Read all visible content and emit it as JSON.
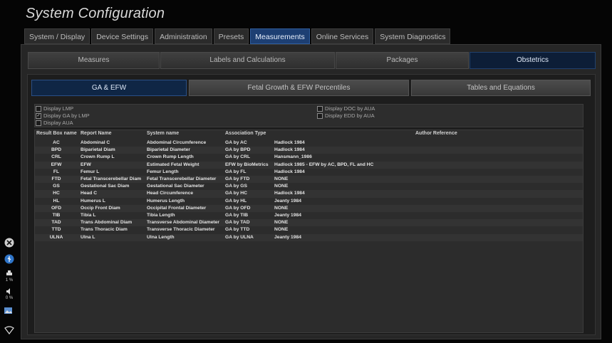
{
  "title": "System Configuration",
  "tabs": [
    "System / Display",
    "Device Settings",
    "Administration",
    "Presets",
    "Measurements",
    "Online Services",
    "System Diagnostics"
  ],
  "active_tab": "Measurements",
  "subtabs": [
    "Measures",
    "Labels and Calculations",
    "Packages",
    "Obstetrics"
  ],
  "active_subtab": "Obstetrics",
  "thirdtabs": [
    "GA & EFW",
    "Fetal Growth & EFW Percentiles",
    "Tables and Equations"
  ],
  "active_thirdtab": "GA & EFW",
  "options": [
    {
      "label": "Display LMP",
      "checked": false
    },
    {
      "label": "Display GA by LMP",
      "checked": true
    },
    {
      "label": "Display AUA",
      "checked": false
    },
    {
      "label": "Display DOC by AUA",
      "checked": false
    },
    {
      "label": "Display EDD by AUA",
      "checked": false
    }
  ],
  "table": {
    "headers": [
      "Result Box name",
      "Report Name",
      "System name",
      "Association Type",
      "Author Reference"
    ],
    "rows": [
      [
        "AC",
        "Abdominal C",
        "Abdominal Circumference",
        "GA by AC",
        "Hadlock 1984"
      ],
      [
        "BPD",
        "Biparietal Diam",
        "Biparietal Diameter",
        "GA by BPD",
        "Hadlock 1984"
      ],
      [
        "CRL",
        "Crown Rump L",
        "Crown Rump Length",
        "GA by CRL",
        "Hansmann_1986"
      ],
      [
        "EFW",
        "EFW",
        "Estimated Fetal Weight",
        "EFW by BioMetrics",
        "Hadlock 1985 - EFW by AC, BPD, FL and HC"
      ],
      [
        "FL",
        "Femur L",
        "Femur Length",
        "GA by FL",
        "Hadlock 1984"
      ],
      [
        "FTD",
        "Fetal Transcerebellar Diam",
        "Fetal Transcerebellar Diameter",
        "GA by FTD",
        "NONE"
      ],
      [
        "GS",
        "Gestational Sac Diam",
        "Gestational Sac Diameter",
        "GA by GS",
        "NONE"
      ],
      [
        "HC",
        "Head C",
        "Head Circumference",
        "GA by HC",
        "Hadlock 1984"
      ],
      [
        "HL",
        "Humerus L",
        "Humerus Length",
        "GA by HL",
        "Jeanty 1984"
      ],
      [
        "OFD",
        "Occip Front Diam",
        "Occipital Frontal Diameter",
        "GA by OFD",
        "NONE"
      ],
      [
        "TIB",
        "Tibia L",
        "Tibia Length",
        "GA by TIB",
        "Jeanty 1984"
      ],
      [
        "TAD",
        "Trans Abdominal Diam",
        "Transverse Abdominal Diameter",
        "GA by TAD",
        "NONE"
      ],
      [
        "TTD",
        "Trans Thoracic Diam",
        "Transverse Thoracic Diameter",
        "GA by TTD",
        "NONE"
      ],
      [
        "ULNA",
        "Ulna L",
        "Ulna Length",
        "GA by ULNA",
        "Jeanty 1984"
      ]
    ]
  },
  "sidebar": {
    "printer_pct": "1 %",
    "audio_pct": "0 %"
  },
  "colors": {
    "active_tab": "#1d3f73",
    "active_subtab": "#0d1e37",
    "panel": "#262626"
  }
}
